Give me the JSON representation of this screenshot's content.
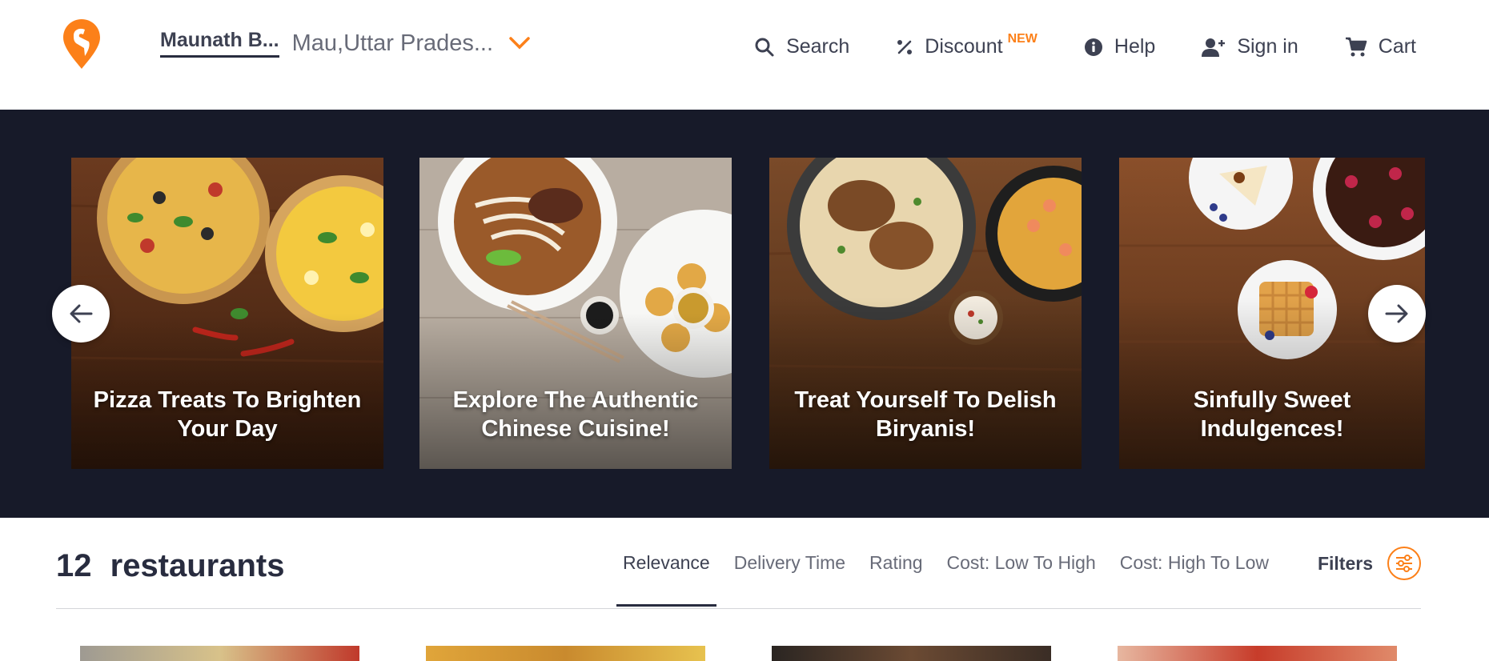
{
  "header": {
    "location_area": "Maunath B...",
    "location_city": "Mau,Uttar Prades...",
    "nav": {
      "search": "Search",
      "discount": "Discount",
      "discount_badge": "NEW",
      "help": "Help",
      "sign_in": "Sign in",
      "cart": "Cart"
    }
  },
  "carousel": {
    "cards": [
      {
        "title": "Pizza Treats To Brighten Your Day"
      },
      {
        "title": "Explore The Authentic Chinese Cuisine!"
      },
      {
        "title": "Treat Yourself To Delish Biryanis!"
      },
      {
        "title": "Sinfully Sweet Indulgences!"
      }
    ]
  },
  "list": {
    "count_number": "12",
    "count_label": "restaurants",
    "sort_options": [
      "Relevance",
      "Delivery Time",
      "Rating",
      "Cost: Low To High",
      "Cost: High To Low"
    ],
    "active_sort": "Relevance",
    "filters_label": "Filters"
  },
  "colors": {
    "brand": "#fc8019",
    "carousel_bg": "#171a29",
    "text_dark": "#3d4152"
  }
}
